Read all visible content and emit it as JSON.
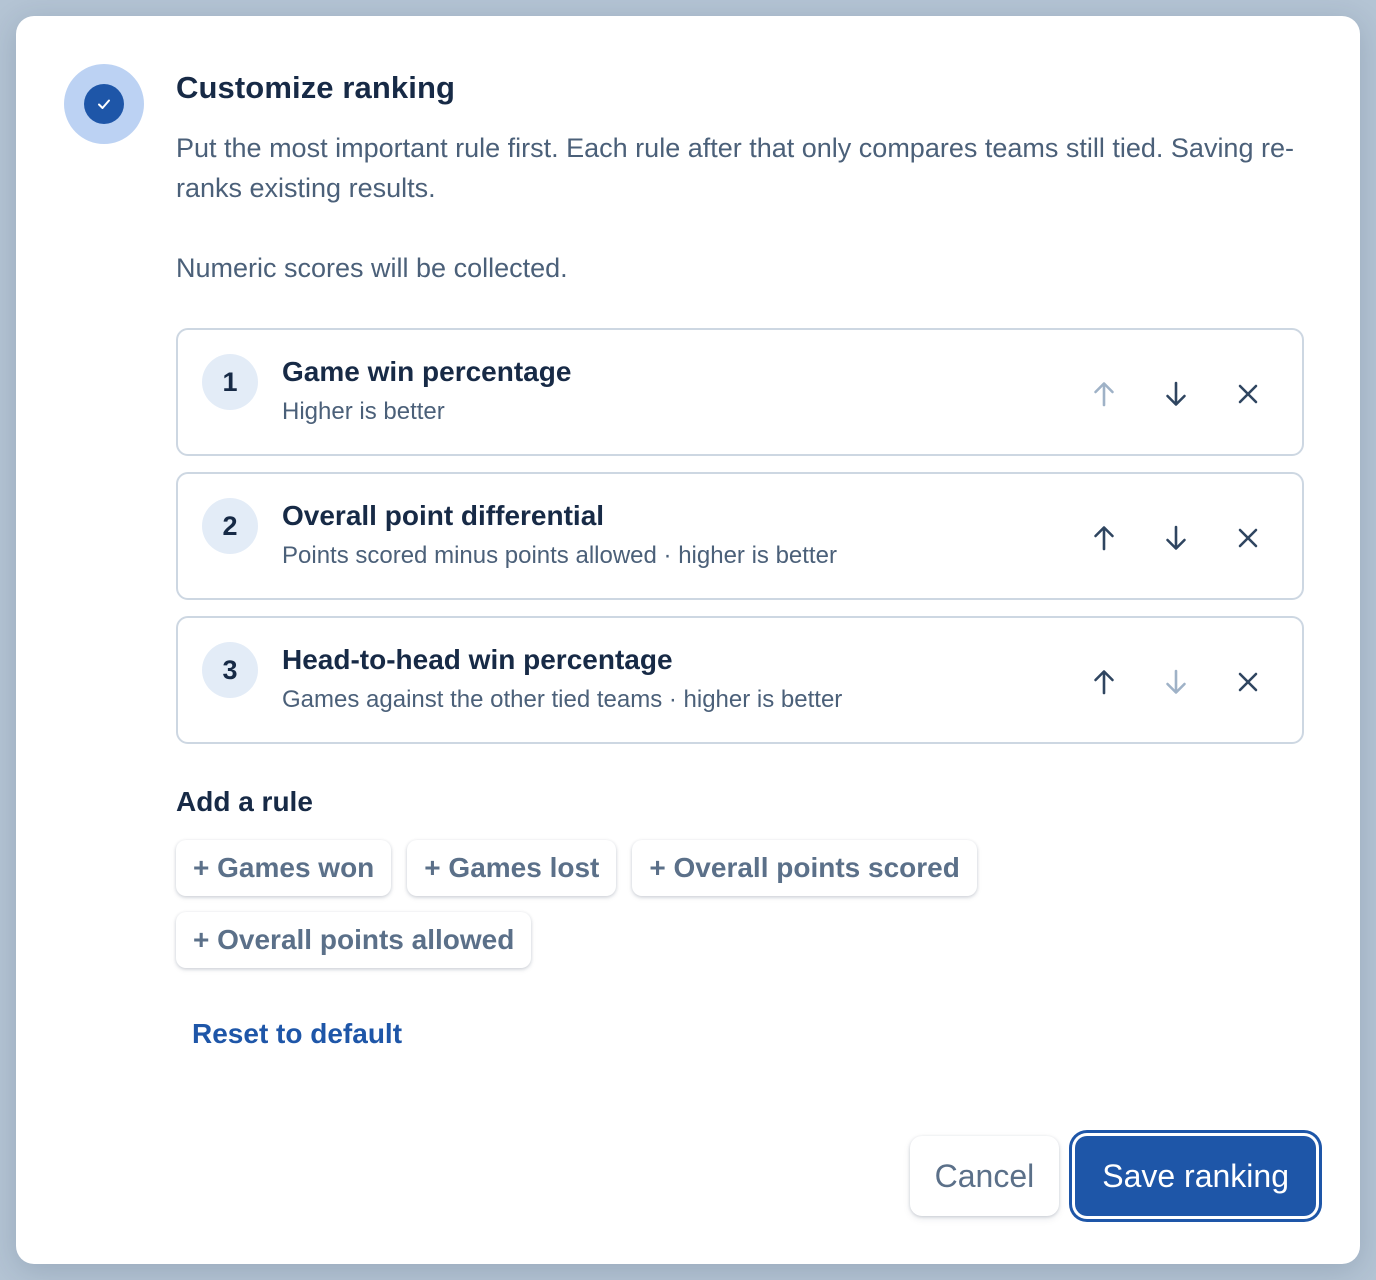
{
  "dialog": {
    "title": "Customize ranking",
    "description": "Put the most important rule first. Each rule after that only compares teams still tied. Saving re-ranks existing results.",
    "note": "Numeric scores will be collected."
  },
  "colors": {
    "accent": "#1e56a8",
    "badge_bg": "#bcd2f3",
    "text_primary": "#172a46",
    "text_secondary": "#4b6079",
    "icon_enabled": "#2f4560",
    "icon_disabled": "#9fb2c7"
  },
  "rules": [
    {
      "number": "1",
      "name": "Game win percentage",
      "subtitle": "Higher is better",
      "move_up_enabled": false,
      "move_down_enabled": true
    },
    {
      "number": "2",
      "name": "Overall point differential",
      "subtitle": "Points scored minus points allowed · higher is better",
      "move_up_enabled": true,
      "move_down_enabled": true
    },
    {
      "number": "3",
      "name": "Head-to-head win percentage",
      "subtitle": "Games against the other tied teams · higher is better",
      "move_up_enabled": true,
      "move_down_enabled": false
    }
  ],
  "rule_icons": {
    "up": "arrow-up-icon",
    "down": "arrow-down-icon",
    "remove": "close-icon"
  },
  "add_rule": {
    "title": "Add a rule",
    "options": [
      "+ Games won",
      "+ Games lost",
      "+ Overall points scored",
      "+ Overall points allowed"
    ]
  },
  "reset_label": "Reset to default",
  "footer": {
    "cancel_label": "Cancel",
    "save_label": "Save ranking"
  }
}
